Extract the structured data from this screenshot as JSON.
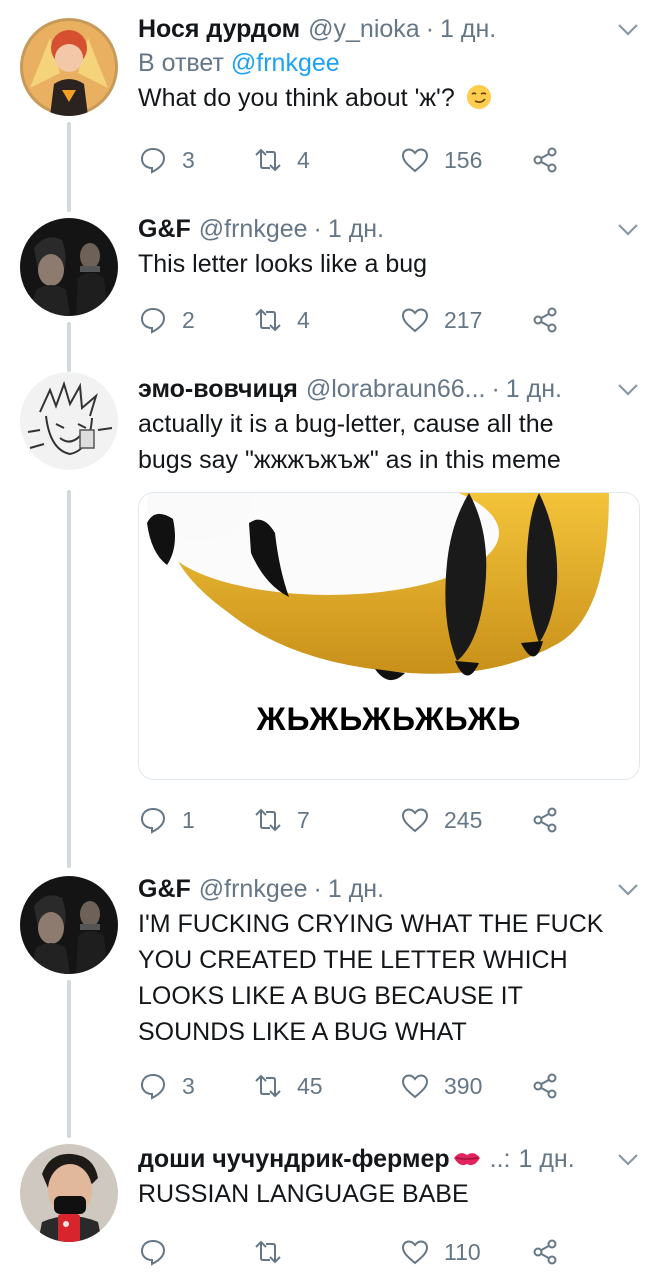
{
  "tweets": [
    {
      "name": "Нося дурдом",
      "handle": "@y_nioka",
      "time": "1 дн.",
      "reply_label": "В ответ",
      "reply_to": "@frnkgee",
      "text": "What do you think about 'ж'?",
      "emoji": "smirking-face",
      "replies": "3",
      "retweets": "4",
      "likes": "156"
    },
    {
      "name": "G&F",
      "handle": "@frnkgee",
      "time": "1 дн.",
      "text": "This letter looks like a bug",
      "replies": "2",
      "retweets": "4",
      "likes": "217"
    },
    {
      "name": "эмо-вовчиця",
      "handle": "@lorabraun66...",
      "time": "1 дн.",
      "text_lines": [
        "actually it is a bug-letter, cause all the",
        "bugs say \"жжжъжъж\" as in this meme"
      ],
      "media_caption": "ЖЬЖЬЖЬЖЬЖЬ",
      "replies": "1",
      "retweets": "7",
      "likes": "245"
    },
    {
      "name": "G&F",
      "handle": "@frnkgee",
      "time": "1 дн.",
      "text_lines": [
        "I'M FUCKING CRYING WHAT THE FUCK",
        "YOU CREATED THE LETTER WHICH",
        "LOOKS LIKE A BUG BECAUSE IT",
        "SOUNDS LIKE A BUG WHAT"
      ],
      "replies": "3",
      "retweets": "45",
      "likes": "390"
    },
    {
      "name": "доши чучундрик-фермер",
      "name_emoji": "kiss-mark",
      "handle": "..:",
      "time": "1 дн.",
      "text": "RUSSIAN LANGUAGE BABE",
      "replies": "",
      "retweets": "",
      "likes": "110"
    }
  ],
  "colors": {
    "text": "#14171a",
    "secondary": "#657786",
    "accent": "#1da1f2",
    "thread_line": "#cfd9de"
  }
}
